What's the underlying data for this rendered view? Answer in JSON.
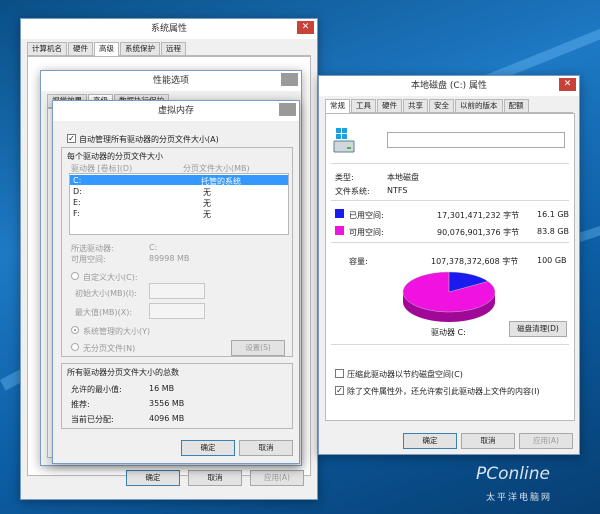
{
  "colors": {
    "used": "#1b1bf0",
    "free": "#f012e0",
    "accent": "#c7433a"
  },
  "sysprops": {
    "title": "系统属性",
    "tabs": [
      "计算机名",
      "硬件",
      "高级",
      "系统保护",
      "远程"
    ],
    "active_tab": 2,
    "ok": "确定",
    "cancel": "取消",
    "apply": "应用(A)"
  },
  "perf": {
    "title": "性能选项",
    "tab_left": "视觉效果",
    "tab_mid": "高级",
    "tab_right": "数据执行保护"
  },
  "vm": {
    "title": "虚拟内存",
    "auto_manage": "自动管理所有驱动器的分页文件大小(A)",
    "auto_checked": "✓",
    "section_title": "每个驱动器的分页文件大小",
    "col_drive": "驱动器 [卷标](D)",
    "col_size": "分页文件大小(MB)",
    "drives": [
      {
        "drive": "C:",
        "size": "托管的系统"
      },
      {
        "drive": "D:",
        "size": "无"
      },
      {
        "drive": "E:",
        "size": "无"
      },
      {
        "drive": "F:",
        "size": "无"
      }
    ],
    "selected_drive_label": "所选驱动器:",
    "selected_drive_value": "C:",
    "available_label": "可用空间:",
    "available_value": "89998 MB",
    "custom_size": "自定义大小(C):",
    "initial_size": "初始大小(MB)(I):",
    "max_size": "最大值(MB)(X):",
    "system_managed": "系统管理的大小(Y)",
    "no_paging": "无分页文件(N)",
    "set_button": "设置(S)",
    "total_title": "所有驱动器分页文件大小的总数",
    "min_label": "允许的最小值:",
    "min_value": "16 MB",
    "rec_label": "推荐:",
    "rec_value": "3556 MB",
    "cur_label": "当前已分配:",
    "cur_value": "4096 MB",
    "ok": "确定",
    "cancel": "取消"
  },
  "disk": {
    "title": "本地磁盘 (C:) 属性",
    "tabs": [
      "常规",
      "工具",
      "硬件",
      "共享",
      "安全",
      "以前的版本",
      "配额"
    ],
    "active_tab": 0,
    "name_value": "",
    "type_label": "类型:",
    "type_value": "本地磁盘",
    "fs_label": "文件系统:",
    "fs_value": "NTFS",
    "used_label": "已用空间:",
    "used_bytes": "17,301,471,232 字节",
    "used_gb": "16.1 GB",
    "free_label": "可用空间:",
    "free_bytes": "90,076,901,376 字节",
    "free_gb": "83.8 GB",
    "cap_label": "容量:",
    "cap_bytes": "107,378,372,608 字节",
    "cap_gb": "100 GB",
    "used_fraction": 0.161,
    "drive_label": "驱动器 C:",
    "cleanup": "磁盘清理(D)",
    "compress": "压缩此驱动器以节约磁盘空间(C)",
    "compress_checked": "",
    "index": "除了文件属性外，还允许索引此驱动器上文件的内容(I)",
    "index_checked": "✓",
    "ok": "确定",
    "cancel": "取消",
    "apply": "应用(A)"
  },
  "watermark": {
    "brand": "PConline",
    "sub": "太平洋电脑网"
  }
}
